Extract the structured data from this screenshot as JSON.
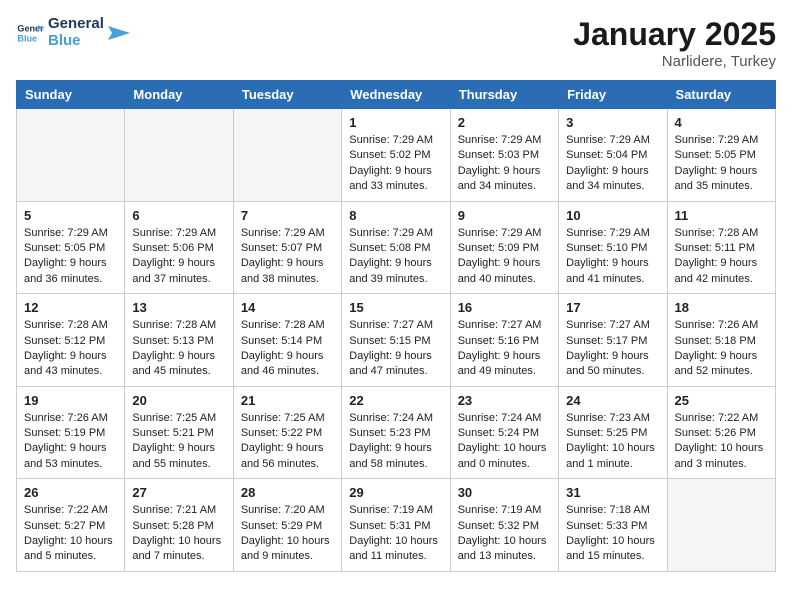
{
  "header": {
    "logo_general": "General",
    "logo_blue": "Blue",
    "month": "January 2025",
    "location": "Narlidere, Turkey"
  },
  "days_of_week": [
    "Sunday",
    "Monday",
    "Tuesday",
    "Wednesday",
    "Thursday",
    "Friday",
    "Saturday"
  ],
  "weeks": [
    [
      {
        "day": "",
        "empty": true
      },
      {
        "day": "",
        "empty": true
      },
      {
        "day": "",
        "empty": true
      },
      {
        "day": "1",
        "sunrise": "7:29 AM",
        "sunset": "5:02 PM",
        "daylight": "9 hours and 33 minutes."
      },
      {
        "day": "2",
        "sunrise": "7:29 AM",
        "sunset": "5:03 PM",
        "daylight": "9 hours and 34 minutes."
      },
      {
        "day": "3",
        "sunrise": "7:29 AM",
        "sunset": "5:04 PM",
        "daylight": "9 hours and 34 minutes."
      },
      {
        "day": "4",
        "sunrise": "7:29 AM",
        "sunset": "5:05 PM",
        "daylight": "9 hours and 35 minutes."
      }
    ],
    [
      {
        "day": "5",
        "sunrise": "7:29 AM",
        "sunset": "5:05 PM",
        "daylight": "9 hours and 36 minutes."
      },
      {
        "day": "6",
        "sunrise": "7:29 AM",
        "sunset": "5:06 PM",
        "daylight": "9 hours and 37 minutes."
      },
      {
        "day": "7",
        "sunrise": "7:29 AM",
        "sunset": "5:07 PM",
        "daylight": "9 hours and 38 minutes."
      },
      {
        "day": "8",
        "sunrise": "7:29 AM",
        "sunset": "5:08 PM",
        "daylight": "9 hours and 39 minutes."
      },
      {
        "day": "9",
        "sunrise": "7:29 AM",
        "sunset": "5:09 PM",
        "daylight": "9 hours and 40 minutes."
      },
      {
        "day": "10",
        "sunrise": "7:29 AM",
        "sunset": "5:10 PM",
        "daylight": "9 hours and 41 minutes."
      },
      {
        "day": "11",
        "sunrise": "7:28 AM",
        "sunset": "5:11 PM",
        "daylight": "9 hours and 42 minutes."
      }
    ],
    [
      {
        "day": "12",
        "sunrise": "7:28 AM",
        "sunset": "5:12 PM",
        "daylight": "9 hours and 43 minutes."
      },
      {
        "day": "13",
        "sunrise": "7:28 AM",
        "sunset": "5:13 PM",
        "daylight": "9 hours and 45 minutes."
      },
      {
        "day": "14",
        "sunrise": "7:28 AM",
        "sunset": "5:14 PM",
        "daylight": "9 hours and 46 minutes."
      },
      {
        "day": "15",
        "sunrise": "7:27 AM",
        "sunset": "5:15 PM",
        "daylight": "9 hours and 47 minutes."
      },
      {
        "day": "16",
        "sunrise": "7:27 AM",
        "sunset": "5:16 PM",
        "daylight": "9 hours and 49 minutes."
      },
      {
        "day": "17",
        "sunrise": "7:27 AM",
        "sunset": "5:17 PM",
        "daylight": "9 hours and 50 minutes."
      },
      {
        "day": "18",
        "sunrise": "7:26 AM",
        "sunset": "5:18 PM",
        "daylight": "9 hours and 52 minutes."
      }
    ],
    [
      {
        "day": "19",
        "sunrise": "7:26 AM",
        "sunset": "5:19 PM",
        "daylight": "9 hours and 53 minutes."
      },
      {
        "day": "20",
        "sunrise": "7:25 AM",
        "sunset": "5:21 PM",
        "daylight": "9 hours and 55 minutes."
      },
      {
        "day": "21",
        "sunrise": "7:25 AM",
        "sunset": "5:22 PM",
        "daylight": "9 hours and 56 minutes."
      },
      {
        "day": "22",
        "sunrise": "7:24 AM",
        "sunset": "5:23 PM",
        "daylight": "9 hours and 58 minutes."
      },
      {
        "day": "23",
        "sunrise": "7:24 AM",
        "sunset": "5:24 PM",
        "daylight": "10 hours and 0 minutes."
      },
      {
        "day": "24",
        "sunrise": "7:23 AM",
        "sunset": "5:25 PM",
        "daylight": "10 hours and 1 minute."
      },
      {
        "day": "25",
        "sunrise": "7:22 AM",
        "sunset": "5:26 PM",
        "daylight": "10 hours and 3 minutes."
      }
    ],
    [
      {
        "day": "26",
        "sunrise": "7:22 AM",
        "sunset": "5:27 PM",
        "daylight": "10 hours and 5 minutes."
      },
      {
        "day": "27",
        "sunrise": "7:21 AM",
        "sunset": "5:28 PM",
        "daylight": "10 hours and 7 minutes."
      },
      {
        "day": "28",
        "sunrise": "7:20 AM",
        "sunset": "5:29 PM",
        "daylight": "10 hours and 9 minutes."
      },
      {
        "day": "29",
        "sunrise": "7:19 AM",
        "sunset": "5:31 PM",
        "daylight": "10 hours and 11 minutes."
      },
      {
        "day": "30",
        "sunrise": "7:19 AM",
        "sunset": "5:32 PM",
        "daylight": "10 hours and 13 minutes."
      },
      {
        "day": "31",
        "sunrise": "7:18 AM",
        "sunset": "5:33 PM",
        "daylight": "10 hours and 15 minutes."
      },
      {
        "day": "",
        "empty": true
      }
    ]
  ]
}
